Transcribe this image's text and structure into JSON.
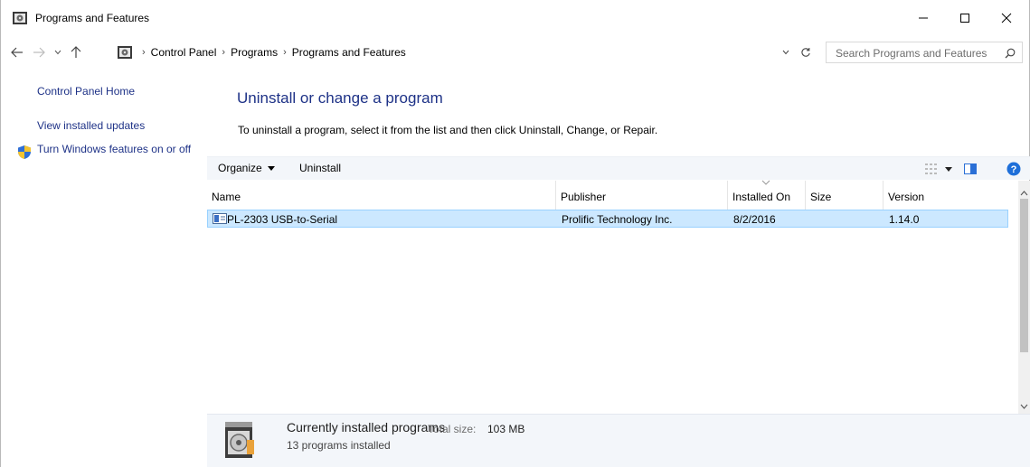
{
  "window": {
    "title": "Programs and Features",
    "controls": {
      "minimize": "minimize",
      "maximize": "maximize",
      "close": "close"
    }
  },
  "address": {
    "breadcrumbs": [
      "Control Panel",
      "Programs",
      "Programs and Features"
    ],
    "search_placeholder": "Search Programs and Features"
  },
  "sidebar": {
    "links": [
      "Control Panel Home",
      "View installed updates",
      "Turn Windows features on or off"
    ]
  },
  "main": {
    "heading": "Uninstall or change a program",
    "instruction": "To uninstall a program, select it from the list and then click Uninstall, Change, or Repair."
  },
  "toolbar": {
    "organize": "Organize",
    "uninstall": "Uninstall"
  },
  "list": {
    "columns": [
      "Name",
      "Publisher",
      "Installed On",
      "Size",
      "Version"
    ],
    "rows": [
      {
        "name": "PL-2303 USB-to-Serial",
        "publisher": "Prolific Technology Inc.",
        "installed_on": "8/2/2016",
        "size": "",
        "version": "1.14.0",
        "selected": true
      }
    ]
  },
  "details": {
    "title": "Currently installed programs",
    "total_size_label": "Total size:",
    "total_size_value": "103 MB",
    "count": "13 programs installed"
  },
  "colors": {
    "link": "#1e3287",
    "selection": "#cce8ff",
    "selection_border": "#99d1ff",
    "toolbar_bg": "#f3f6fa"
  }
}
